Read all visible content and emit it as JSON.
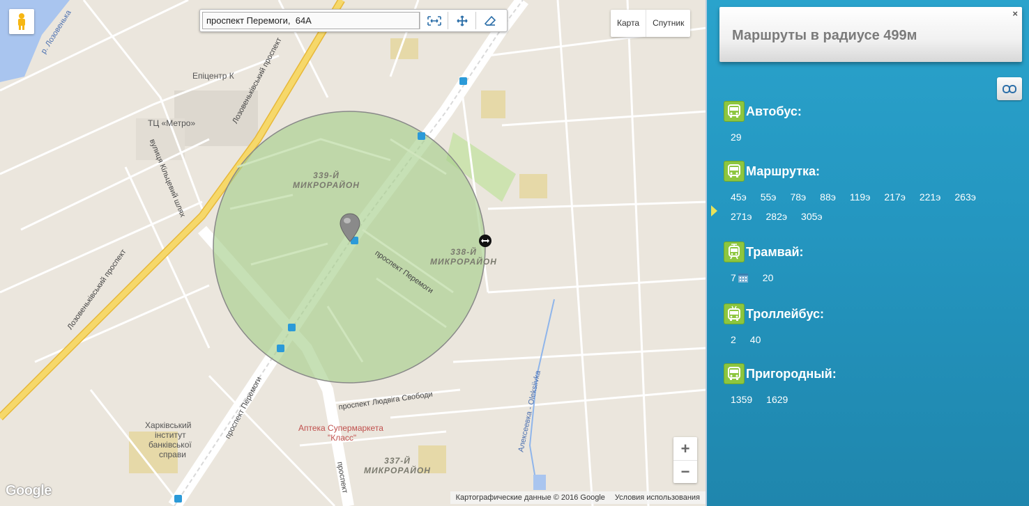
{
  "map": {
    "address_value": "проспект Перемоги,  64А",
    "map_type": {
      "map_label": "Карта",
      "satellite_label": "Спутник"
    },
    "labels": {
      "epicentr": "Епіцентр К",
      "metro": "ТЦ «Метро»",
      "kiltsevyi": "вулиця Кільцевий шлях",
      "lozovenkivskyi_1": "Лозовеньківський проспект",
      "lozovenkivskyi_2": "Лозовеньківський проспект",
      "river": "р. Лозовенька",
      "mikr_339": "339-Й МИКРОРАЙОН",
      "mikr_338": "338-Й МИКРОРАЙОН",
      "mikr_337": "337-Й МИКРОРАЙОН",
      "peremohy_1": "проспект Перемоги",
      "peremohy_2": "проспект Перемоги",
      "peremohy_3": "проспект",
      "svobody": "проспект Людвіга Свободи",
      "apteka_1": "Аптека Супермаркета",
      "apteka_2": "\"Класс\"",
      "institute_1": "Харківський",
      "institute_2": "інститут",
      "institute_3": "банківської",
      "institute_4": "справи",
      "oleksiivka": "Алексеевка - Oleksiivka"
    },
    "zoom_in": "+",
    "zoom_out": "−",
    "logo": "Google",
    "attribution_data": "Картографические данные © 2016 Google",
    "attribution_terms": "Условия использования"
  },
  "panel": {
    "title": "Маршруты в радиусе 499м",
    "close": "×",
    "categories": [
      {
        "title": "Автобус:",
        "icon": "bus-icon",
        "routes": [
          "29"
        ]
      },
      {
        "title": "Маршрутка:",
        "icon": "minibus-icon",
        "routes": [
          "45э",
          "55э",
          "78э",
          "88э",
          "119э",
          "217э",
          "221э",
          "263э",
          "271э",
          "282э",
          "305э"
        ]
      },
      {
        "title": "Трамвай:",
        "icon": "tram-icon",
        "routes": [
          "7",
          "20"
        ]
      },
      {
        "title": "Троллейбус:",
        "icon": "trolleybus-icon",
        "routes": [
          "2",
          "40"
        ]
      },
      {
        "title": "Пригородный:",
        "icon": "suburban-bus-icon",
        "routes": [
          "1359",
          "1629"
        ]
      }
    ]
  },
  "colors": {
    "panel_bg": "#2496c0",
    "icon_green": "#8dc63f",
    "radius_fill": "#a8d08d",
    "highway": "#f3d15a"
  }
}
